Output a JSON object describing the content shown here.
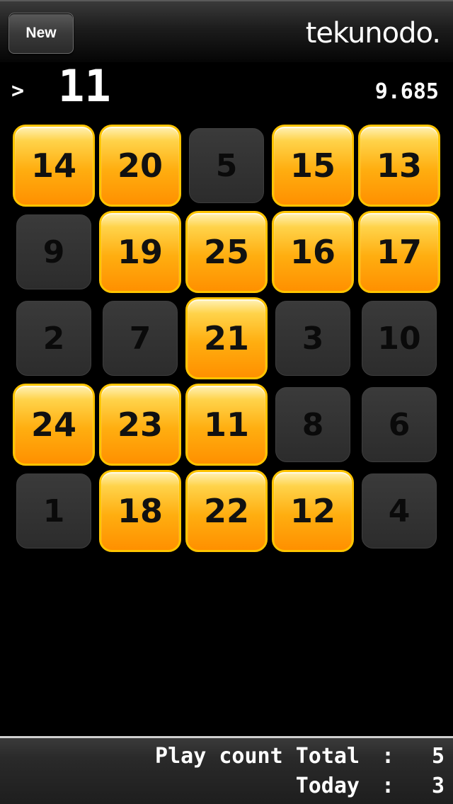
{
  "header": {
    "new_label": "New",
    "logo_text": "tekunodo."
  },
  "status": {
    "prompt": ">",
    "target": "11",
    "timer": "9.685"
  },
  "board": {
    "highlight_color": "#ffa500",
    "tiles": [
      {
        "value": "14",
        "lit": true
      },
      {
        "value": "20",
        "lit": true
      },
      {
        "value": "5",
        "lit": false
      },
      {
        "value": "15",
        "lit": true
      },
      {
        "value": "13",
        "lit": true
      },
      {
        "value": "9",
        "lit": false
      },
      {
        "value": "19",
        "lit": true
      },
      {
        "value": "25",
        "lit": true
      },
      {
        "value": "16",
        "lit": true
      },
      {
        "value": "17",
        "lit": true
      },
      {
        "value": "2",
        "lit": false
      },
      {
        "value": "7",
        "lit": false
      },
      {
        "value": "21",
        "lit": true
      },
      {
        "value": "3",
        "lit": false
      },
      {
        "value": "10",
        "lit": false
      },
      {
        "value": "24",
        "lit": true
      },
      {
        "value": "23",
        "lit": true
      },
      {
        "value": "11",
        "lit": true
      },
      {
        "value": "8",
        "lit": false
      },
      {
        "value": "6",
        "lit": false
      },
      {
        "value": "1",
        "lit": false
      },
      {
        "value": "18",
        "lit": true
      },
      {
        "value": "22",
        "lit": true
      },
      {
        "value": "12",
        "lit": true
      },
      {
        "value": "4",
        "lit": false
      }
    ]
  },
  "footer": {
    "total_label": "Play count Total",
    "today_label": "Today",
    "colon": ":",
    "total_value": "5",
    "today_value": "3"
  }
}
